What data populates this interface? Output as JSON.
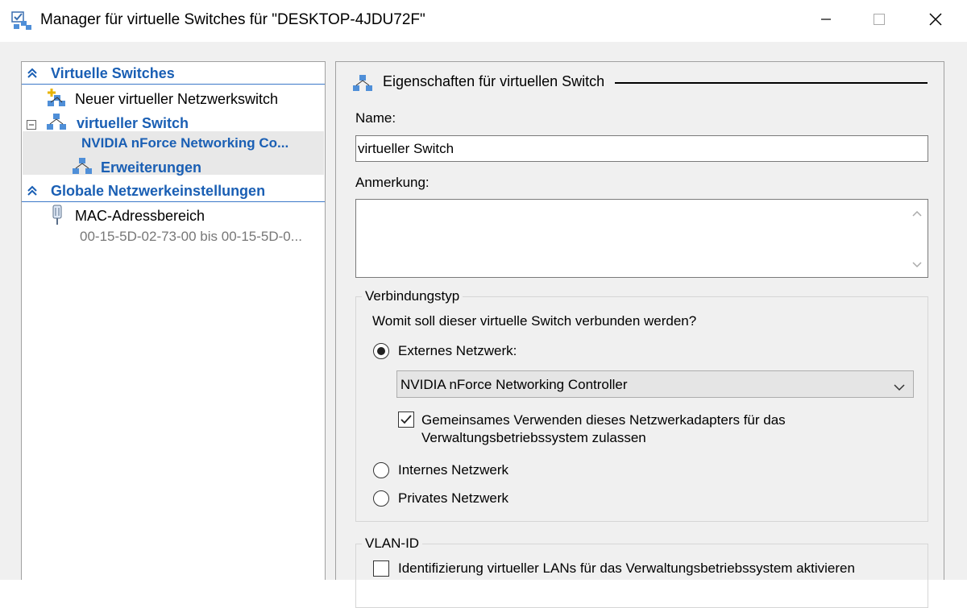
{
  "window": {
    "title": "Manager für virtuelle Switches für \"DESKTOP-4JDU72F\"",
    "app_icon": "switch-manager-icon",
    "controls": [
      "minimize-icon",
      "maximize-icon",
      "close-icon"
    ]
  },
  "left_pane": {
    "sections": [
      {
        "header": "Virtuelle Switches",
        "items": [
          {
            "label": "Neuer virtueller Netzwerkswitch",
            "icon": "new-switch-icon"
          },
          {
            "label": "virtueller Switch",
            "sublabel": "NVIDIA nForce Networking Co...",
            "icon": "switch-icon",
            "expanded": true,
            "selected": true
          },
          {
            "label": "Erweiterungen",
            "icon": "extensions-icon"
          }
        ]
      },
      {
        "header": "Globale Netzwerkeinstellungen",
        "items": [
          {
            "label": "MAC-Adressbereich",
            "sublabel": "00-15-5D-02-73-00 bis 00-15-5D-0...",
            "icon": "mac-address-icon"
          }
        ]
      }
    ]
  },
  "right_pane": {
    "header": "Eigenschaften für virtuellen Switch",
    "name_label": "Name:",
    "name_value": "virtueller Switch",
    "notes_label": "Anmerkung:",
    "notes_value": "",
    "connection_group": {
      "title": "Verbindungstyp",
      "question": "Womit soll dieser virtuelle Switch verbunden werden?",
      "options": [
        {
          "label": "Externes Netzwerk:",
          "checked": true
        },
        {
          "label": "Internes Netzwerk",
          "checked": false
        },
        {
          "label": "Privates Netzwerk",
          "checked": false
        }
      ],
      "adapter_selected": "NVIDIA nForce Networking Controller",
      "share_adapter_label": "Gemeinsames Verwenden dieses Netzwerkadapters für das Verwaltungsbetriebssystem zulassen",
      "share_adapter_checked": true
    },
    "vlan_group": {
      "title": "VLAN-ID",
      "enable_label": "Identifizierung virtueller LANs für das Verwaltungsbetriebssystem aktivieren",
      "enable_checked": false
    }
  },
  "colors": {
    "accent_blue": "#1a5fb4",
    "selection_bg": "#e8e8e8",
    "window_bg": "#f0f0f0"
  }
}
